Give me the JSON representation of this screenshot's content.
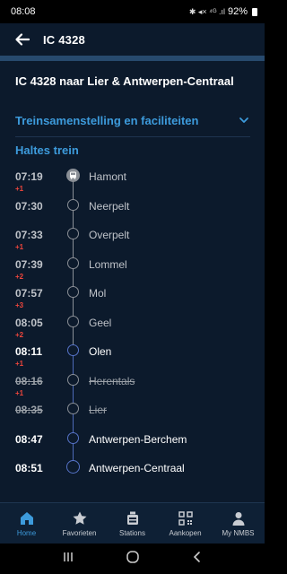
{
  "statusbar": {
    "time": "08:08",
    "icons_text": "✱ ◂× ⁴ᴳ .ıl",
    "battery": "92%"
  },
  "appbar": {
    "title": "IC 4328",
    "back_icon": "arrow-left-icon"
  },
  "train_header": "IC 4328 naar Lier & Antwerpen-Centraal",
  "composition": {
    "label": "Treinsamenstelling en faciliteiten",
    "icon": "chevron-down-icon"
  },
  "stops_heading": "Haltes trein",
  "stops": [
    {
      "time": "07:19",
      "delay": "+1",
      "name": "Hamont",
      "state": "past",
      "marker": "bus"
    },
    {
      "time": "07:30",
      "delay": "",
      "name": "Neerpelt",
      "state": "past"
    },
    {
      "time": "07:33",
      "delay": "+1",
      "name": "Overpelt",
      "state": "past"
    },
    {
      "time": "07:39",
      "delay": "+2",
      "name": "Lommel",
      "state": "past"
    },
    {
      "time": "07:57",
      "delay": "+3",
      "name": "Mol",
      "state": "past"
    },
    {
      "time": "08:05",
      "delay": "+2",
      "name": "Geel",
      "state": "past"
    },
    {
      "time": "08:11",
      "delay": "+1",
      "name": "Olen",
      "state": "current"
    },
    {
      "time": "08:16",
      "delay": "+1",
      "name": "Herentals",
      "state": "cancelled"
    },
    {
      "time": "08:35",
      "delay": "",
      "name": "Lier",
      "state": "cancelled"
    },
    {
      "time": "08:47",
      "delay": "",
      "name": "Antwerpen-Berchem",
      "state": "future"
    },
    {
      "time": "08:51",
      "delay": "",
      "name": "Antwerpen-Centraal",
      "state": "future"
    }
  ],
  "bottom_nav": [
    {
      "label": "Home",
      "icon": "home-icon",
      "active": true
    },
    {
      "label": "Favorieten",
      "icon": "star-icon",
      "active": false
    },
    {
      "label": "Stations",
      "icon": "station-icon",
      "active": false
    },
    {
      "label": "Aankopen",
      "icon": "qr-code-icon",
      "active": false
    },
    {
      "label": "My NMBS",
      "icon": "person-icon",
      "active": false
    }
  ],
  "colors": {
    "accent": "#3d9bdc",
    "delay": "#f0463c",
    "background": "#0c1a2c",
    "future_line": "#4e69b7"
  }
}
